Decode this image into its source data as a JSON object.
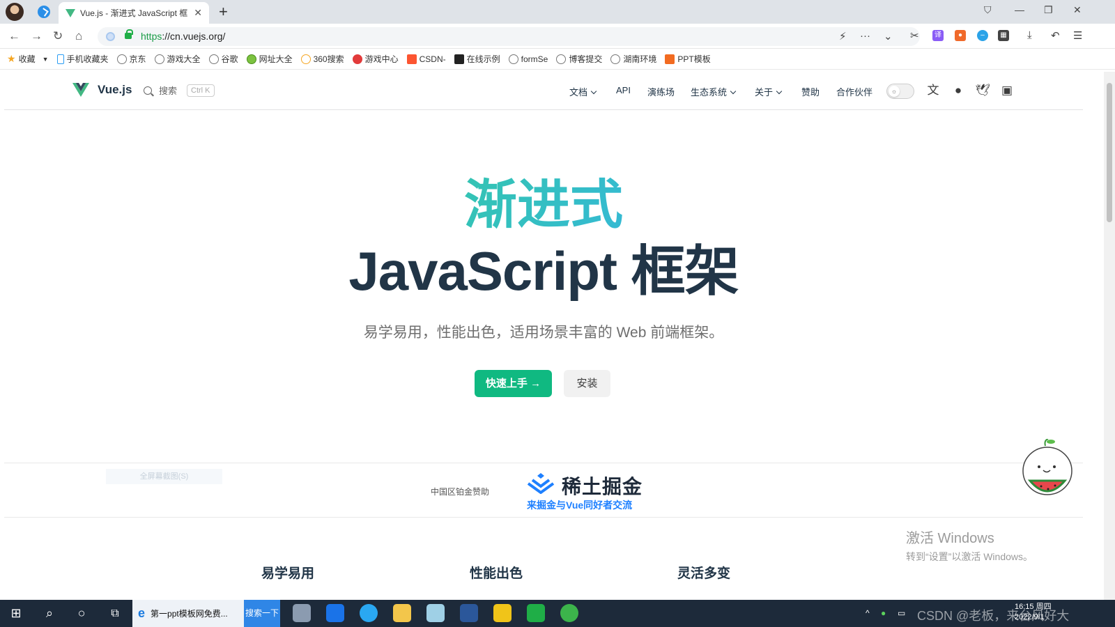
{
  "browser": {
    "tab_title": "Vue.js - 渐进式 JavaScript 框",
    "tab_close": "✕",
    "new_tab": "+",
    "url_scheme": "https",
    "url_rest": "://cn.vuejs.org/",
    "bookmarks": [
      "收藏",
      "手机收藏夹",
      "京东",
      "游戏大全",
      "谷歌",
      "网址大全",
      "360搜索",
      "游戏中心",
      "CSDN-",
      "在线示例",
      "formSe",
      "博客提交",
      "湖南环境",
      "PPT模板"
    ]
  },
  "vue_nav": {
    "brand": "Vue.js",
    "search_label": "搜索",
    "search_kbd": "Ctrl K",
    "menu": [
      "文档",
      "API",
      "演练场",
      "生态系统",
      "关于",
      "赞助",
      "合作伙伴"
    ]
  },
  "hero": {
    "title_1": "渐进式",
    "title_2": "JavaScript 框架",
    "tagline": "易学易用，性能出色，适用场景丰富的 Web 前端框架。",
    "start_button": "快速上手 →",
    "install_button": "安装"
  },
  "sponsor": {
    "label": "中国区铂金赞助",
    "ghost_text": "全屏幕截图(S)",
    "name": "稀土掘金",
    "slogan": "来掘金与Vue同好者交流"
  },
  "features": [
    "易学易用",
    "性能出色",
    "灵活多变"
  ],
  "watermark": {
    "line1": "激活 Windows",
    "line2": "转到“设置”以激活 Windows。"
  },
  "taskbar": {
    "ie_title": "第一ppt模板网免费...",
    "search_button": "搜索一下",
    "clock_time": "16:15 周四",
    "clock_date": "2022/9/1",
    "csdn_watermark": "CSDN @老板，来台风好大"
  },
  "colors": {
    "vue_green": "#42b883",
    "brand_dark": "#213547",
    "start_button": "#10b981",
    "juejin_blue": "#1e80ff"
  }
}
